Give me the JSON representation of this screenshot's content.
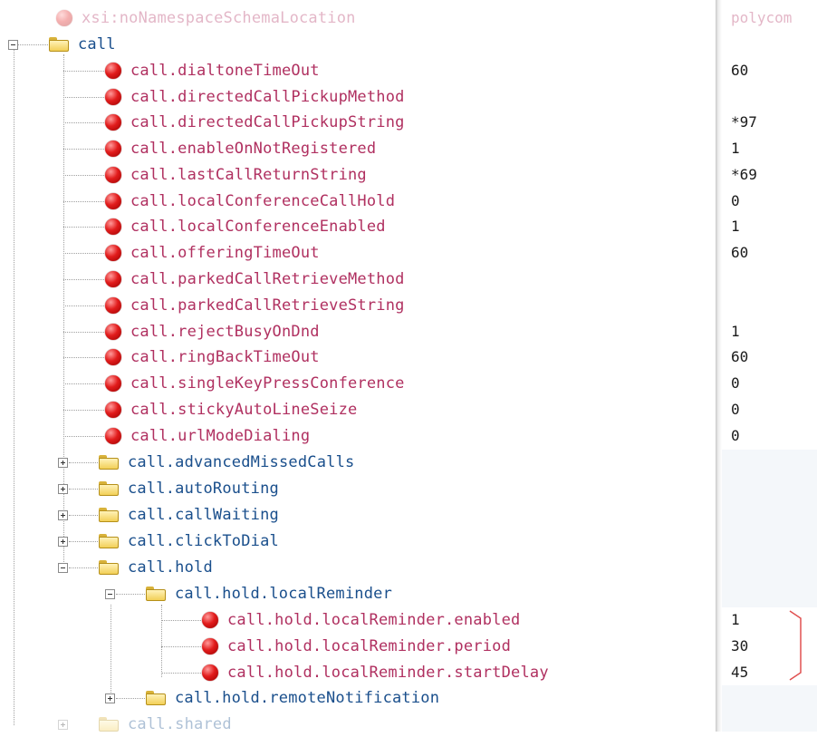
{
  "tree": {
    "schema_attr": {
      "name": "xsi:noNamespaceSchemaLocation",
      "value": "polycom"
    },
    "root_folder": "call",
    "attributes": [
      {
        "name": "call.dialtoneTimeOut",
        "value": "60"
      },
      {
        "name": "call.directedCallPickupMethod",
        "value": ""
      },
      {
        "name": "call.directedCallPickupString",
        "value": "*97"
      },
      {
        "name": "call.enableOnNotRegistered",
        "value": "1"
      },
      {
        "name": "call.lastCallReturnString",
        "value": "*69"
      },
      {
        "name": "call.localConferenceCallHold",
        "value": "0"
      },
      {
        "name": "call.localConferenceEnabled",
        "value": "1"
      },
      {
        "name": "call.offeringTimeOut",
        "value": "60"
      },
      {
        "name": "call.parkedCallRetrieveMethod",
        "value": ""
      },
      {
        "name": "call.parkedCallRetrieveString",
        "value": ""
      },
      {
        "name": "call.rejectBusyOnDnd",
        "value": "1"
      },
      {
        "name": "call.ringBackTimeOut",
        "value": "60"
      },
      {
        "name": "call.singleKeyPressConference",
        "value": "0"
      },
      {
        "name": "call.stickyAutoLineSeize",
        "value": "0"
      },
      {
        "name": "call.urlModeDialing",
        "value": "0"
      }
    ],
    "sub_folders": [
      "call.advancedMissedCalls",
      "call.autoRouting",
      "call.callWaiting",
      "call.clickToDial"
    ],
    "hold_folder": "call.hold",
    "local_reminder_folder": "call.hold.localReminder",
    "local_reminder_attributes": [
      {
        "name": "call.hold.localReminder.enabled",
        "value": "1"
      },
      {
        "name": "call.hold.localReminder.period",
        "value": "30"
      },
      {
        "name": "call.hold.localReminder.startDelay",
        "value": "45"
      }
    ],
    "remote_notification_folder": "call.hold.remoteNotification",
    "shared_folder": "call.shared"
  },
  "colors": {
    "attribute_text": "#b03060",
    "folder_text": "#1a4f8c",
    "value_text": "#1a1a1a",
    "attribute_icon": "#e21c1c",
    "annotation_bracket": "#e05050"
  },
  "icons": {
    "attribute": "red-ball-icon",
    "folder": "folder-icon",
    "expand": "plus-box-icon",
    "collapse": "minus-box-icon"
  }
}
